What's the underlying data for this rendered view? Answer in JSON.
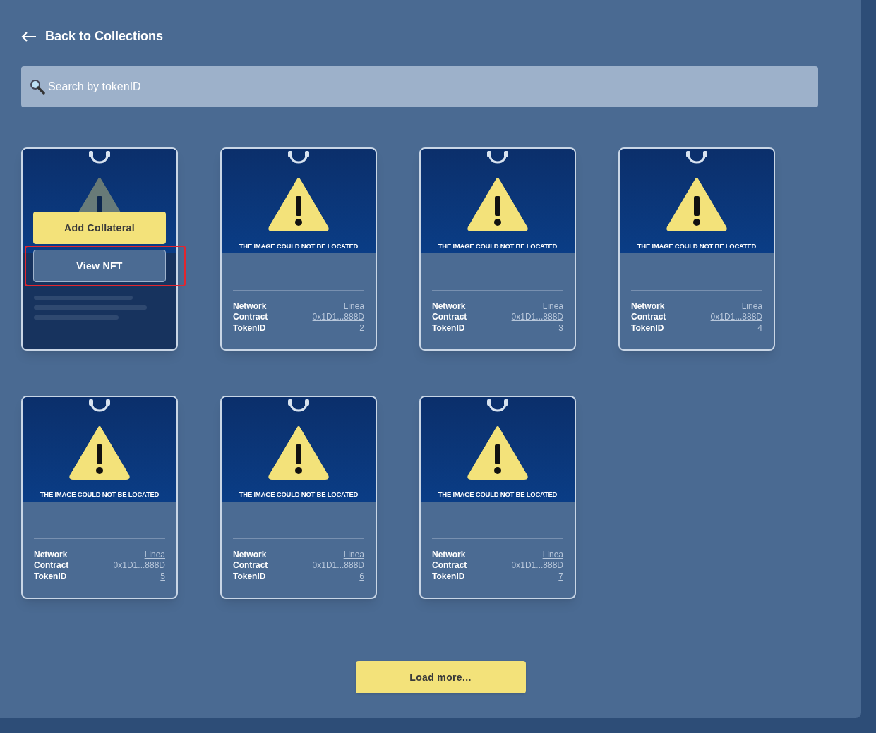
{
  "back_link": {
    "label": "Back to Collections"
  },
  "search": {
    "placeholder": "Search by tokenID"
  },
  "cards": [
    {
      "hovered": true,
      "actions": [
        {
          "label": "Add Collateral",
          "kind": "primary",
          "highlighted": false
        },
        {
          "label": "View NFT",
          "kind": "secondary",
          "highlighted": true
        }
      ]
    },
    {
      "hovered": false,
      "image_caption": "THE IMAGE COULD NOT BE LOCATED",
      "details": [
        {
          "label": "Network",
          "value": "Linea"
        },
        {
          "label": "Contract",
          "value": "0x1D1...888D"
        },
        {
          "label": "TokenID",
          "value": "2"
        }
      ]
    },
    {
      "hovered": false,
      "image_caption": "THE IMAGE COULD NOT BE LOCATED",
      "details": [
        {
          "label": "Network",
          "value": "Linea"
        },
        {
          "label": "Contract",
          "value": "0x1D1...888D"
        },
        {
          "label": "TokenID",
          "value": "3"
        }
      ]
    },
    {
      "hovered": false,
      "image_caption": "THE IMAGE COULD NOT BE LOCATED",
      "details": [
        {
          "label": "Network",
          "value": "Linea"
        },
        {
          "label": "Contract",
          "value": "0x1D1...888D"
        },
        {
          "label": "TokenID",
          "value": "4"
        }
      ]
    },
    {
      "hovered": false,
      "image_caption": "THE IMAGE COULD NOT BE LOCATED",
      "details": [
        {
          "label": "Network",
          "value": "Linea"
        },
        {
          "label": "Contract",
          "value": "0x1D1...888D"
        },
        {
          "label": "TokenID",
          "value": "5"
        }
      ]
    },
    {
      "hovered": false,
      "image_caption": "THE IMAGE COULD NOT BE LOCATED",
      "details": [
        {
          "label": "Network",
          "value": "Linea"
        },
        {
          "label": "Contract",
          "value": "0x1D1...888D"
        },
        {
          "label": "TokenID",
          "value": "6"
        }
      ]
    },
    {
      "hovered": false,
      "image_caption": "THE IMAGE COULD NOT BE LOCATED",
      "details": [
        {
          "label": "Network",
          "value": "Linea"
        },
        {
          "label": "Contract",
          "value": "0x1D1...888D"
        },
        {
          "label": "TokenID",
          "value": "7"
        }
      ]
    }
  ],
  "load_more": {
    "label": "Load more..."
  }
}
